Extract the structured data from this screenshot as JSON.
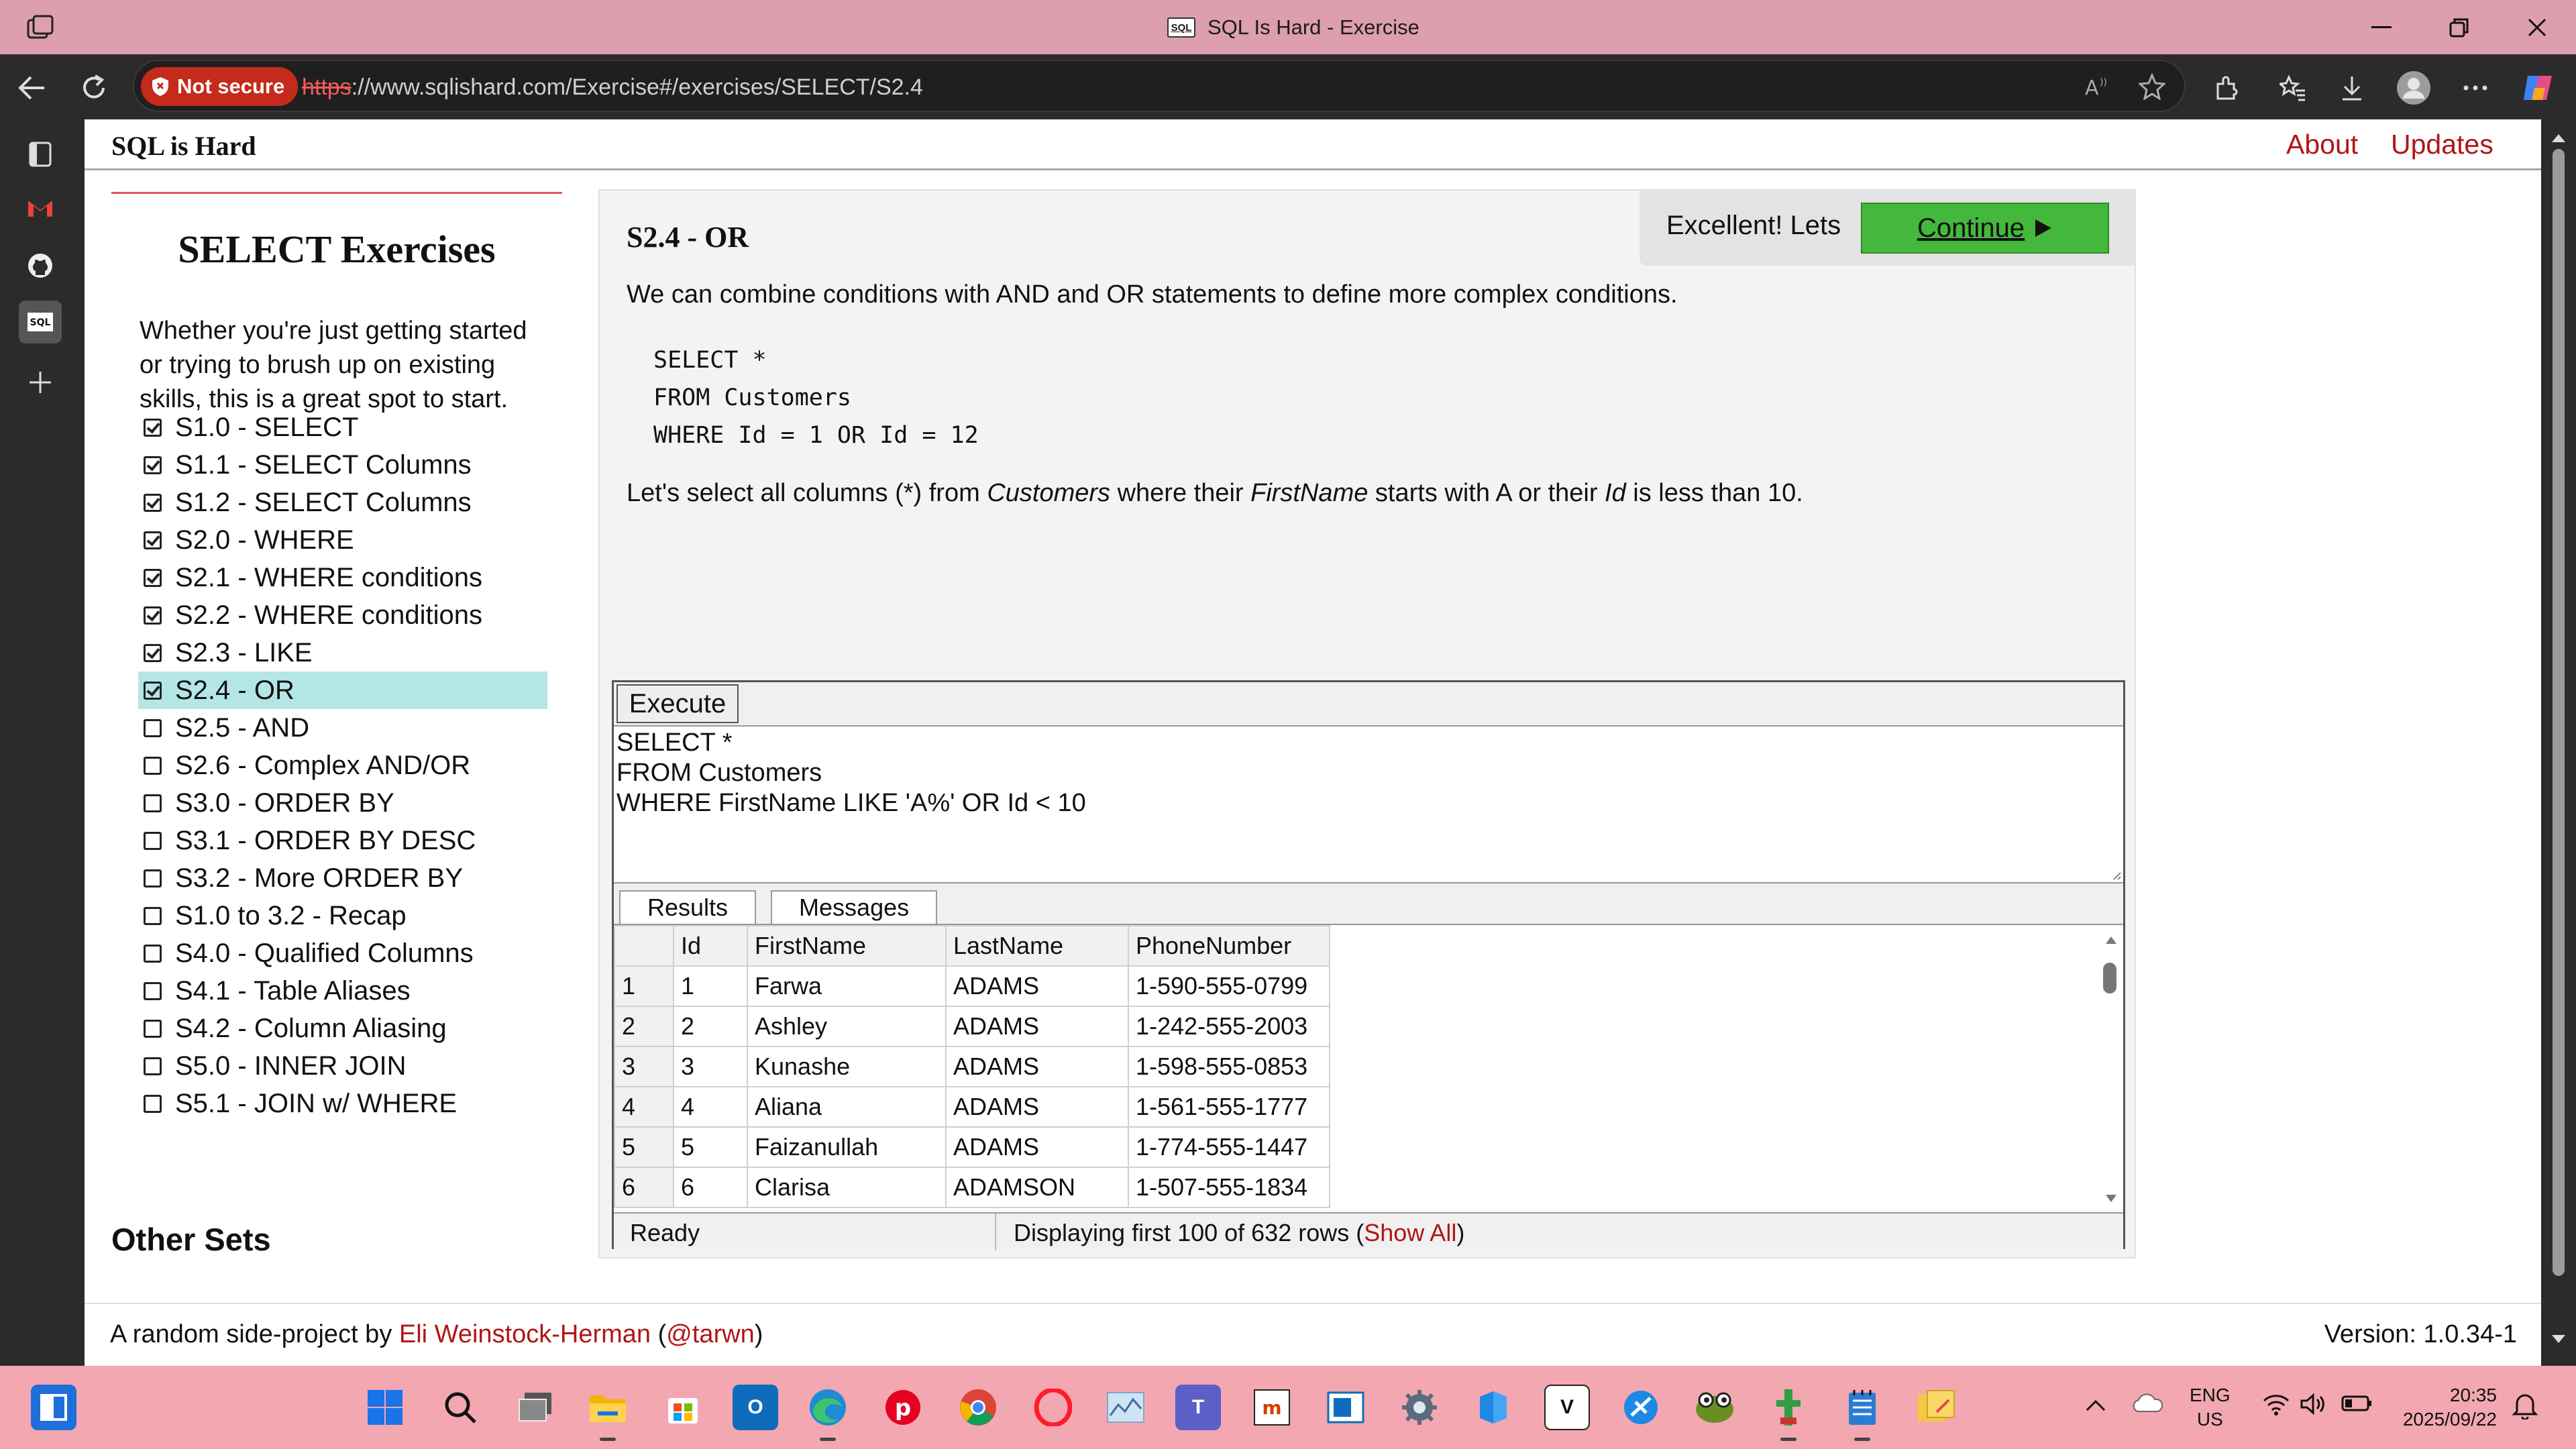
{
  "browser": {
    "window_title": "SQL Is Hard - Exercise",
    "favicon_text": "SQL",
    "security_label": "Not secure",
    "url_scheme": "https",
    "url_rest": "://www.sqlishard.com/Exercise#/exercises/SELECT/S2.4"
  },
  "site": {
    "brand": "SQL is Hard",
    "nav": [
      "About",
      "Updates"
    ]
  },
  "left": {
    "title": "SELECT Exercises",
    "intro": "Whether you're just getting started or trying to brush up on existing skills, this is a great spot to start.",
    "exercises": [
      {
        "label": "S1.0 - SELECT",
        "done": true
      },
      {
        "label": "S1.1 - SELECT Columns",
        "done": true
      },
      {
        "label": "S1.2 - SELECT Columns",
        "done": true
      },
      {
        "label": "S2.0 - WHERE",
        "done": true
      },
      {
        "label": "S2.1 - WHERE conditions",
        "done": true
      },
      {
        "label": "S2.2 - WHERE conditions",
        "done": true
      },
      {
        "label": "S2.3 - LIKE",
        "done": true
      },
      {
        "label": "S2.4 - OR",
        "done": true,
        "active": true
      },
      {
        "label": "S2.5 - AND",
        "done": false
      },
      {
        "label": "S2.6 - Complex AND/OR",
        "done": false
      },
      {
        "label": "S3.0 - ORDER BY",
        "done": false
      },
      {
        "label": "S3.1 - ORDER BY DESC",
        "done": false
      },
      {
        "label": "S3.2 - More ORDER BY",
        "done": false
      },
      {
        "label": "S1.0 to 3.2 - Recap",
        "done": false
      },
      {
        "label": "S4.0 - Qualified Columns",
        "done": false
      },
      {
        "label": "S4.1 - Table Aliases",
        "done": false
      },
      {
        "label": "S4.2 - Column Aliasing",
        "done": false
      },
      {
        "label": "S5.0 - INNER JOIN",
        "done": false
      },
      {
        "label": "S5.1 - JOIN w/ WHERE",
        "done": false
      }
    ],
    "other_sets": "Other Sets"
  },
  "exercise": {
    "title": "S2.4 - OR",
    "description": "We can combine conditions with AND and OR statements to define more complex conditions.",
    "example_code": "SELECT *\nFROM Customers\nWHERE Id = 1 OR Id = 12",
    "prompt_parts": [
      "Let's select all columns (*) from ",
      "Customers",
      " where their ",
      "FirstName",
      " starts with A or their ",
      "Id",
      " is less than 10."
    ],
    "success_text": "Excellent! Lets",
    "continue_label": "Continue"
  },
  "editor": {
    "execute_label": "Execute",
    "sql": "SELECT *\nFROM Customers\nWHERE FirstName LIKE 'A%' OR Id < 10",
    "tabs": [
      "Results",
      "Messages"
    ],
    "columns": [
      "Id",
      "FirstName",
      "LastName",
      "PhoneNumber"
    ],
    "rows": [
      [
        "1",
        "1",
        "Farwa",
        "ADAMS",
        "1-590-555-0799"
      ],
      [
        "2",
        "2",
        "Ashley",
        "ADAMS",
        "1-242-555-2003"
      ],
      [
        "3",
        "3",
        "Kunashe",
        "ADAMS",
        "1-598-555-0853"
      ],
      [
        "4",
        "4",
        "Aliana",
        "ADAMS",
        "1-561-555-1777"
      ],
      [
        "5",
        "5",
        "Faizanullah",
        "ADAMS",
        "1-774-555-1447"
      ],
      [
        "6",
        "6",
        "Clarisa",
        "ADAMSON",
        "1-507-555-1834"
      ]
    ],
    "status_ready": "Ready",
    "status_display": "Displaying first 100 of 632 rows (",
    "show_all": "Show All",
    "status_close": ")"
  },
  "footer": {
    "prefix": "A random side-project by ",
    "author": "Eli Weinstock-Herman",
    "open_paren": " (",
    "handle": "@tarwn",
    "close_paren": ")",
    "version": "Version: 1.0.34-1"
  },
  "taskbar": {
    "lang": "ENG",
    "region": "US",
    "time": "20:35",
    "date": "2025/09/22"
  },
  "colors": {
    "accent_red": "#b01616",
    "titlebar": "#dd9ead",
    "taskbar": "#f3a7b0",
    "continue_green": "#44b83c",
    "active_item": "#b4e6e6"
  }
}
